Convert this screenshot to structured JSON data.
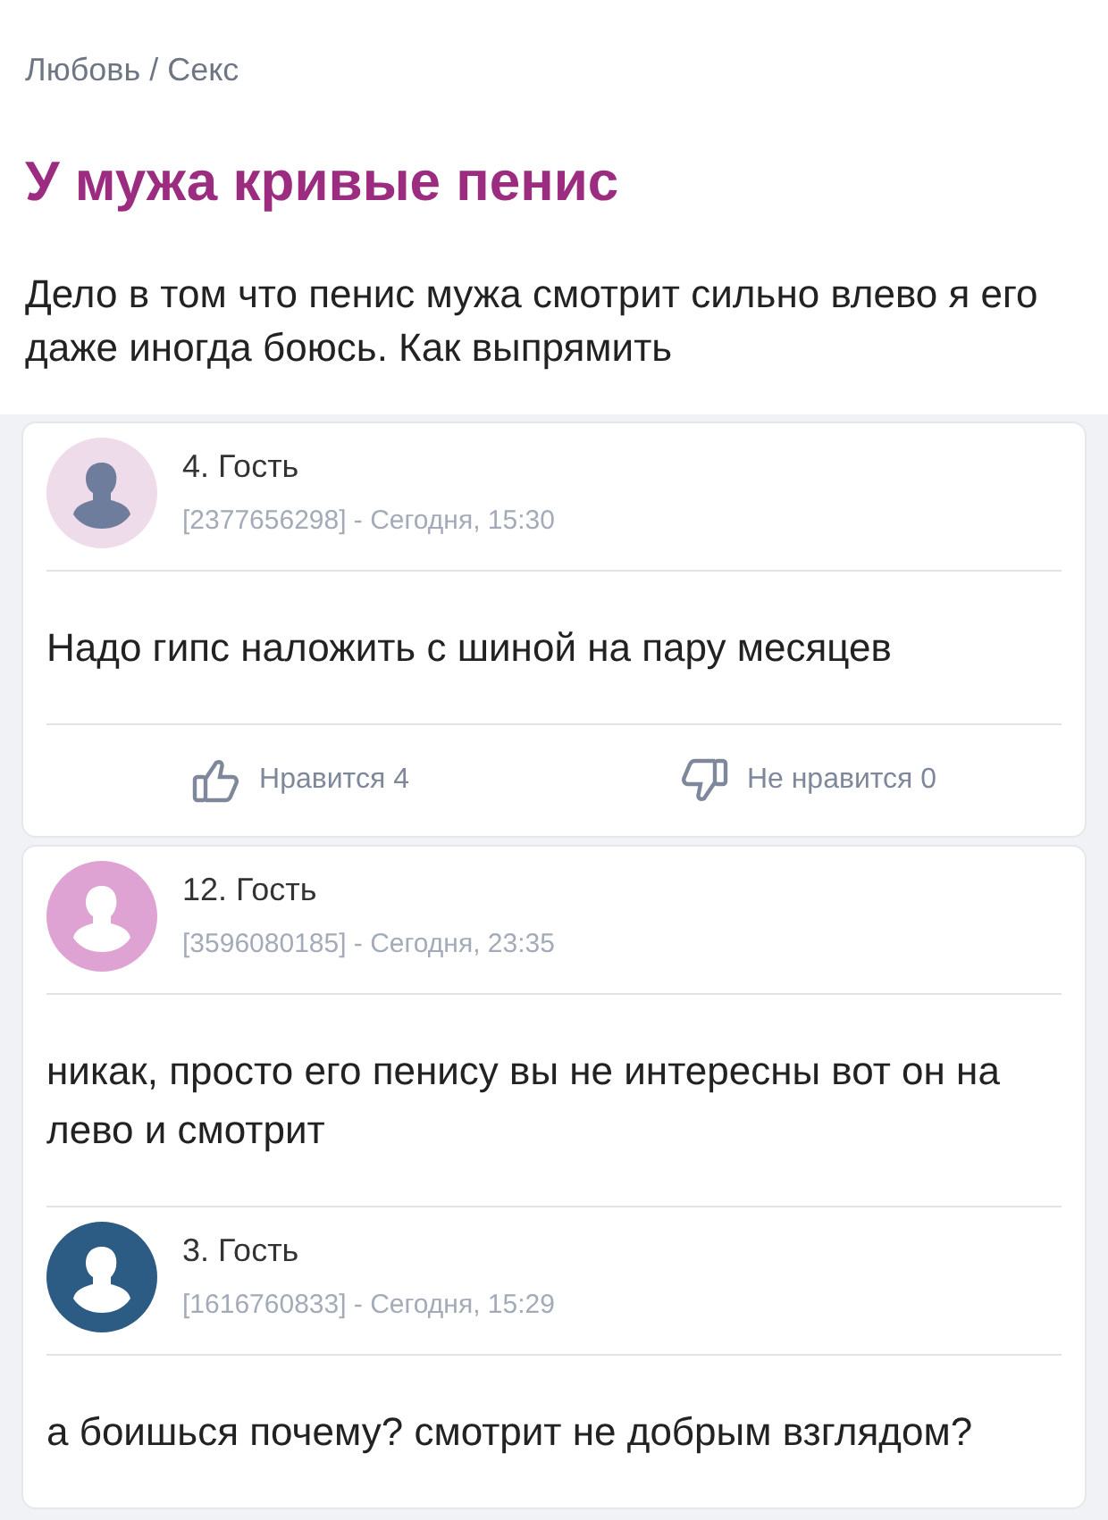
{
  "breadcrumb": "Любовь / Секс",
  "title": "У мужа кривые пенис",
  "question": "Дело в том что пенис мужа смотрит сильно влево я его даже иногда боюсь. Как выпрямить",
  "comments": [
    {
      "name": "4. Гость",
      "meta": "[2377656298] - Сегодня, 15:30",
      "color": "#eedcea",
      "kind": "light",
      "text": "Надо гипс наложить с шиной на пару месяцев",
      "like": "Нравится 4",
      "dislike": "Не нравится 0"
    },
    {
      "name": "12. Гость",
      "meta": "[3596080185] - Сегодня, 23:35",
      "color": "#dfa3d3",
      "kind": "filled",
      "text": "никак, просто его пенису вы не интересны вот он на лево и смотрит",
      "children": [
        {
          "name": "3. Гость",
          "meta": "[1616760833] - Сегодня, 15:29",
          "color": "#2c5b83",
          "kind": "filled",
          "text": "а боишься почему? смотрит не добрым взглядом?"
        }
      ]
    }
  ]
}
